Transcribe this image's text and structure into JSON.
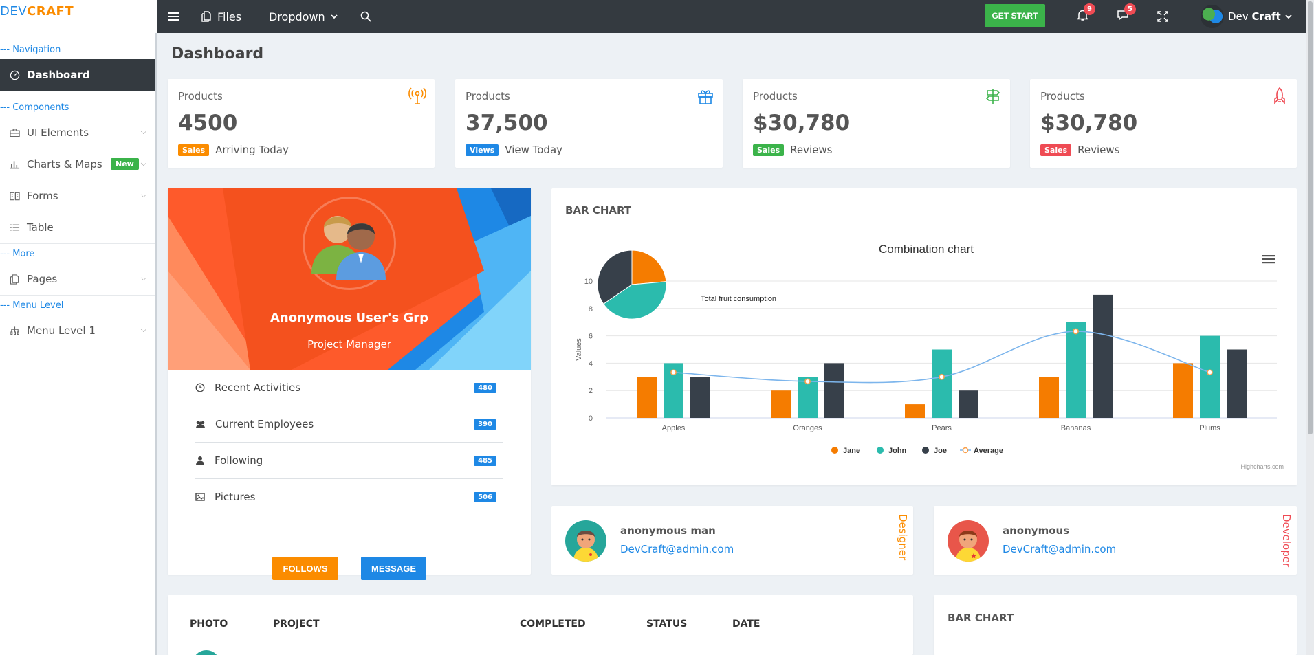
{
  "brand": {
    "part1": "DEV",
    "part2": "CRAFT"
  },
  "header": {
    "files_label": "Files",
    "dropdown_label": "Dropdown",
    "get_start_label": "GET START",
    "notifications_count": "9",
    "messages_count": "5",
    "user_name_first": "Dev",
    "user_name_last": "Craft"
  },
  "sidebar": {
    "captions": {
      "navigation": "--- Navigation",
      "components": "--- Components",
      "more": "--- More",
      "menu_level": "--- Menu Level"
    },
    "items": {
      "dashboard": "Dashboard",
      "ui_elements": "UI Elements",
      "charts_maps": "Charts & Maps",
      "charts_badge": "New",
      "forms": "Forms",
      "table": "Table",
      "pages": "Pages",
      "menu_level_1": "Menu Level 1"
    }
  },
  "page_title": "Dashboard",
  "stats": [
    {
      "label": "Products",
      "value": "4500",
      "tag": "Sales",
      "tag_color": "#fb8c00",
      "foot": "Arriving Today",
      "icon": "antenna-icon",
      "icon_color": "#fb8c00"
    },
    {
      "label": "Products",
      "value": "37,500",
      "tag": "Views",
      "tag_color": "#1e88e5",
      "foot": "View Today",
      "icon": "gift-icon",
      "icon_color": "#1e88e5"
    },
    {
      "label": "Products",
      "value": "$30,780",
      "tag": "Sales",
      "tag_color": "#3bb34a",
      "foot": "Reviews",
      "icon": "signpost-icon",
      "icon_color": "#3bb34a"
    },
    {
      "label": "Products",
      "value": "$30,780",
      "tag": "Sales",
      "tag_color": "#ef4b54",
      "foot": "Reviews",
      "icon": "rocket-icon",
      "icon_color": "#ef4b54"
    }
  ],
  "profile": {
    "name": "Anonymous User's Grp",
    "role": "Project Manager",
    "items": [
      {
        "label": "Recent Activities",
        "count": "480"
      },
      {
        "label": "Current Employees",
        "count": "390"
      },
      {
        "label": "Following",
        "count": "485"
      },
      {
        "label": "Pictures",
        "count": "506"
      }
    ],
    "follows_label": "FOLLOWS",
    "message_label": "MESSAGE"
  },
  "bar_chart_card": {
    "title": "BAR CHART",
    "menu_icon": "hamburger-icon",
    "credit": "Highcharts.com"
  },
  "chart_data": {
    "type": "bar",
    "title": "Combination chart",
    "ylabel": "Values",
    "xlabel": "",
    "ylim": [
      0,
      10
    ],
    "yticks": [
      0,
      2,
      4,
      6,
      8,
      10
    ],
    "categories": [
      "Apples",
      "Oranges",
      "Pears",
      "Bananas",
      "Plums"
    ],
    "series": [
      {
        "name": "Jane",
        "type": "bar",
        "color": "#f57c00",
        "values": [
          3,
          2,
          1,
          3,
          4
        ]
      },
      {
        "name": "John",
        "type": "bar",
        "color": "#2bbbad",
        "values": [
          4,
          3,
          5,
          7,
          6
        ]
      },
      {
        "name": "Joe",
        "type": "bar",
        "color": "#37404a",
        "values": [
          3,
          4,
          2,
          9,
          5
        ]
      },
      {
        "name": "Average",
        "type": "spline",
        "color": "#7cb5ec",
        "values": [
          3.33,
          2.67,
          3,
          6.33,
          3.33
        ]
      }
    ],
    "pie": {
      "label": "Total fruit consumption",
      "slices": [
        {
          "name": "Jane",
          "value": 13,
          "color": "#f57c00"
        },
        {
          "name": "John",
          "value": 23,
          "color": "#2bbbad"
        },
        {
          "name": "Joe",
          "value": 19,
          "color": "#37404a"
        }
      ]
    },
    "legend": "bottom-center",
    "grid": true
  },
  "contacts": [
    {
      "name": "anonymous man",
      "email": "DevCraft@admin.com",
      "role": "Designer",
      "role_color": "#fb8c00",
      "avatar_bg": "#26a69a"
    },
    {
      "name": "anonymous",
      "email": "DevCraft@admin.com",
      "role": "Developer",
      "role_color": "#ef4b54",
      "avatar_bg": "#e8564a"
    }
  ],
  "projects_table": {
    "headers": [
      "PHOTO",
      "PROJECT",
      "COMPLETED",
      "STATUS",
      "DATE"
    ]
  },
  "bar_chart_card_2": {
    "title": "BAR CHART"
  }
}
